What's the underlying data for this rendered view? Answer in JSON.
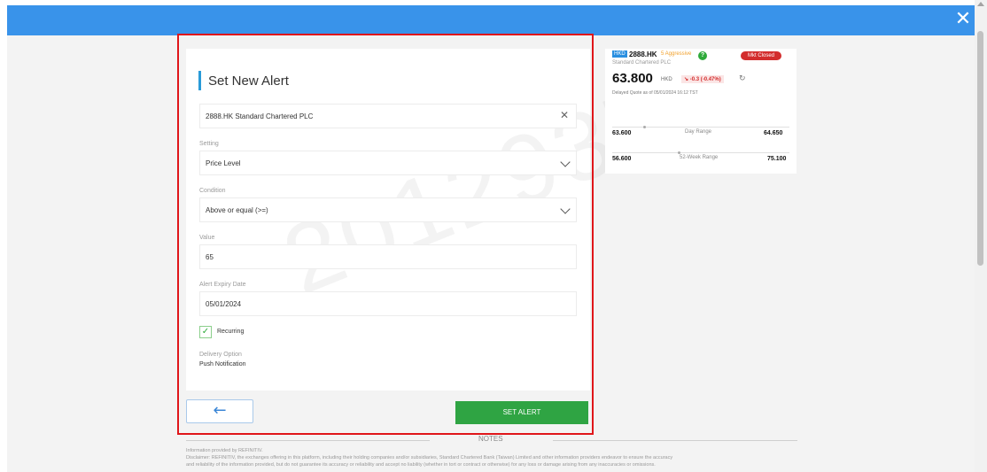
{
  "header": {
    "close_icon": "close-icon",
    "close_glyph": "✕"
  },
  "form": {
    "title": "Set New Alert",
    "search_value": "2888.HK Standard Chartered PLC",
    "clear_glyph": "✕",
    "setting_label": "Setting",
    "setting_value": "Price Level",
    "condition_label": "Condition",
    "condition_value": "Above or equal (>=)",
    "value_label": "Value",
    "value_value": "65",
    "expiry_label": "Alert Expiry Date",
    "expiry_value": "05/01/2024",
    "recurring_label": "Recurring",
    "recurring_checked": true,
    "check_glyph": "✓",
    "delivery_label": "Delivery Option",
    "delivery_value": "Push Notification"
  },
  "actions": {
    "back_glyph": "←",
    "set_alert_label": "SET ALERT"
  },
  "quote": {
    "exchange_badge": "HKD",
    "ticker": "2888.HK",
    "risk_label": "5 Aggressive",
    "help_glyph": "?",
    "status": "Mkt Closed",
    "company": "Standard Chartered PLC",
    "price": "63.800",
    "currency": "HKD",
    "change": "-0.3 (-0.47%)",
    "change_arrow": "↘",
    "refresh_glyph": "↻",
    "delayed_text": "Delayed Quote as of 05/01/2024 16:12 TST",
    "day_low": "63.600",
    "day_label": "Day Range",
    "day_high": "64.650",
    "week_low": "56.600",
    "week_label": "52-Week Range",
    "week_high": "75.100"
  },
  "notes": {
    "title": "NOTES",
    "line1": "Information provided by REFINITIV.",
    "line2": "Disclaimer: REFINITIV, the exchanges offering in this platform, including their holding companies and/or subsidiaries, Standard Chartered Bank (Taiwan) Limited and other information providers endeavor to ensure the accuracy",
    "line3": "and reliability of the information provided, but do not guarantee its accuracy or reliability and accept no liability (whether in tort or contract or otherwise) for any loss or damage arising from any inaccuracies or omissions."
  },
  "watermark": "2012937",
  "colors": {
    "accent": "#3993ea",
    "confirm": "#2fa443",
    "highlight_frame": "#e0161a",
    "negative": "#d32d2d",
    "risk": "#f1a02b"
  }
}
